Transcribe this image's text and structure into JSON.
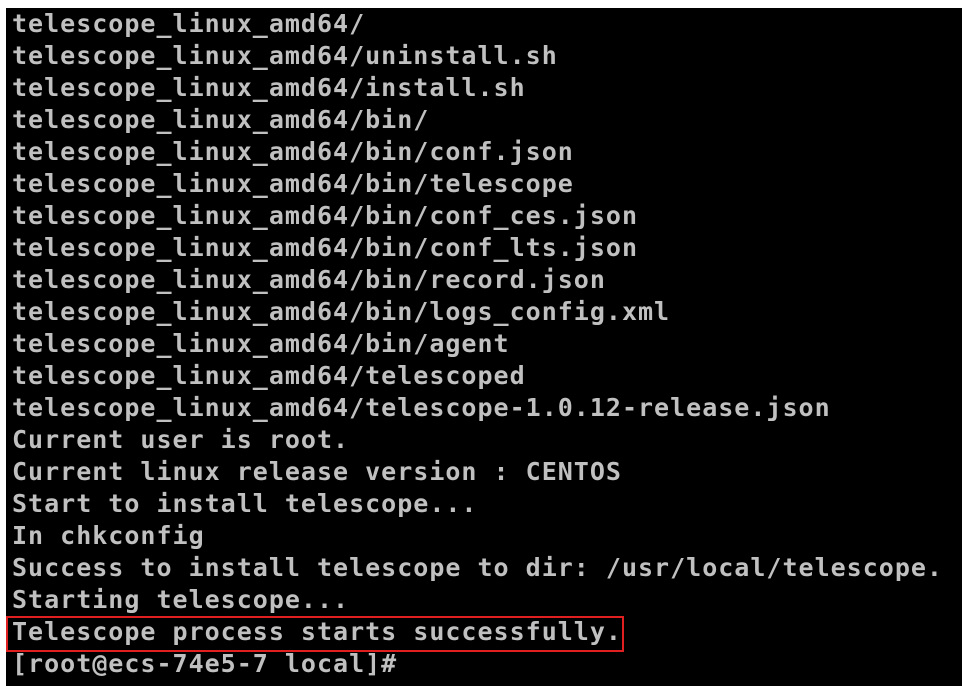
{
  "terminal": {
    "lines": [
      "telescope_linux_amd64/",
      "telescope_linux_amd64/uninstall.sh",
      "telescope_linux_amd64/install.sh",
      "telescope_linux_amd64/bin/",
      "telescope_linux_amd64/bin/conf.json",
      "telescope_linux_amd64/bin/telescope",
      "telescope_linux_amd64/bin/conf_ces.json",
      "telescope_linux_amd64/bin/conf_lts.json",
      "telescope_linux_amd64/bin/record.json",
      "telescope_linux_amd64/bin/logs_config.xml",
      "telescope_linux_amd64/bin/agent",
      "telescope_linux_amd64/telescoped",
      "telescope_linux_amd64/telescope-1.0.12-release.json",
      "Current user is root.",
      "Current linux release version : CENTOS",
      "Start to install telescope...",
      "In chkconfig",
      "Success to install telescope to dir: /usr/local/telescope.",
      "Starting telescope...",
      "Telescope process starts successfully.",
      "[root@ecs-74e5-7 local]#"
    ],
    "highlighted_line": "Telescope process starts successfully.",
    "colors": {
      "background": "#000000",
      "text": "#c0c0c0",
      "highlight_border": "#e02020"
    }
  }
}
